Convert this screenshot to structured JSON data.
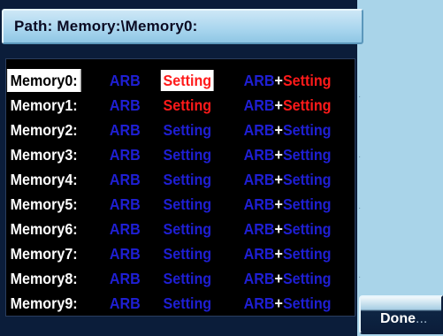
{
  "path": {
    "label": "Path: Memory:\\Memory0:"
  },
  "memory": {
    "rows": [
      {
        "name": "Memory0:",
        "arb": "ARB",
        "setting": "Setting",
        "arb_plus": "ARB",
        "plus": "+",
        "plus_setting": "Setting"
      },
      {
        "name": "Memory1:",
        "arb": "ARB",
        "setting": "Setting",
        "arb_plus": "ARB",
        "plus": "+",
        "plus_setting": "Setting"
      },
      {
        "name": "Memory2:",
        "arb": "ARB",
        "setting": "Setting",
        "arb_plus": "ARB",
        "plus": "+",
        "plus_setting": "Setting"
      },
      {
        "name": "Memory3:",
        "arb": "ARB",
        "setting": "Setting",
        "arb_plus": "ARB",
        "plus": "+",
        "plus_setting": "Setting"
      },
      {
        "name": "Memory4:",
        "arb": "ARB",
        "setting": "Setting",
        "arb_plus": "ARB",
        "plus": "+",
        "plus_setting": "Setting"
      },
      {
        "name": "Memory5:",
        "arb": "ARB",
        "setting": "Setting",
        "arb_plus": "ARB",
        "plus": "+",
        "plus_setting": "Setting"
      },
      {
        "name": "Memory6:",
        "arb": "ARB",
        "setting": "Setting",
        "arb_plus": "ARB",
        "plus": "+",
        "plus_setting": "Setting"
      },
      {
        "name": "Memory7:",
        "arb": "ARB",
        "setting": "Setting",
        "arb_plus": "ARB",
        "plus": "+",
        "plus_setting": "Setting"
      },
      {
        "name": "Memory8:",
        "arb": "ARB",
        "setting": "Setting",
        "arb_plus": "ARB",
        "plus": "+",
        "plus_setting": "Setting"
      },
      {
        "name": "Memory9:",
        "arb": "ARB",
        "setting": "Setting",
        "arb_plus": "ARB",
        "plus": "+",
        "plus_setting": "Setting"
      }
    ]
  },
  "done": {
    "label": "Done",
    "ellipsis": "..."
  },
  "colors": {
    "background": "#a9d4e9",
    "panel": "#0b1d3a",
    "list_bg": "#000000",
    "empty_slot": "#1f1fd4",
    "stored_slot": "#ff1a1a",
    "name_text": "#ffffff"
  }
}
